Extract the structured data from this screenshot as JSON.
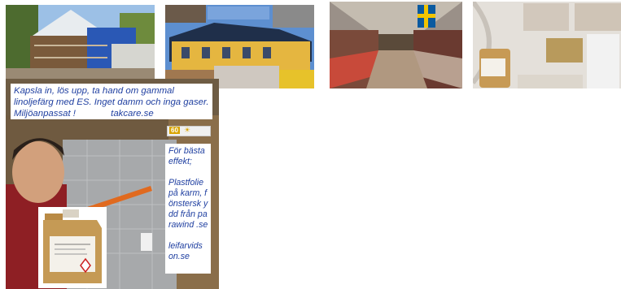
{
  "gallery": [
    {
      "name": "scaffolded-house-photo"
    },
    {
      "name": "yellow-house-collage"
    },
    {
      "name": "market-hall-photo"
    },
    {
      "name": "ceiling-plaster-collage"
    }
  ],
  "collage": {
    "header_text": "Kapsla in, lös upp, ta hand om gammal linoljefärg med ES. Inget damm och inga gaser. Miljöanpassat !",
    "brand": "takcare.se",
    "badge_number": "60",
    "side_lines": [
      "För bästa effekt;",
      "Plastfolie på karm, fönstersk ydd från parawind .se",
      "leifarvids on.se"
    ]
  },
  "colors": {
    "caption_text": "#1f3fa0",
    "jug_liquid": "#c59a55",
    "foil": "#a7a9ab",
    "swedish_flag_blue": "#0a5aa0",
    "swedish_flag_yellow": "#f2c400"
  }
}
